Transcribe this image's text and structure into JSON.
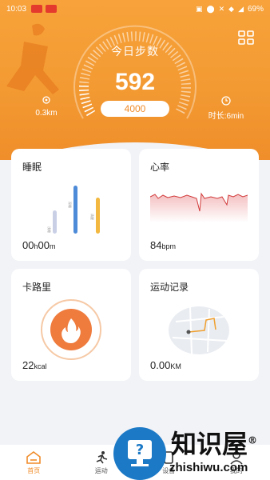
{
  "status_bar": {
    "time": "10:03",
    "battery": "69%"
  },
  "steps": {
    "title": "今日步数",
    "count": "592",
    "goal": "4000",
    "distance": "0.3km",
    "duration": "时长:6min",
    "progress": 0.148
  },
  "cards": {
    "sleep": {
      "title": "睡眠",
      "value_hours": "00",
      "unit_h": "h",
      "value_minutes": "00",
      "unit_m": "m",
      "bars": [
        {
          "label": "浅睡",
          "level": 0.3,
          "color": "#c9d0e6"
        },
        {
          "label": "深睡",
          "level": 0.62,
          "color": "#4d8ad8"
        },
        {
          "label": "清醒",
          "level": 0.46,
          "color": "#f2b840"
        }
      ]
    },
    "heart": {
      "title": "心率",
      "value": "84",
      "unit": "bpm"
    },
    "calories": {
      "title": "卡路里",
      "value": "22",
      "unit": "kcal"
    },
    "record": {
      "title": "运动记录",
      "value": "0.00",
      "unit": "KM"
    }
  },
  "nav": [
    {
      "label": "首页",
      "icon": "home-icon",
      "active": true
    },
    {
      "label": "运动",
      "icon": "run-icon",
      "active": false
    },
    {
      "label": "设备",
      "icon": "device-icon",
      "active": false
    },
    {
      "label": "我的",
      "icon": "profile-icon",
      "active": false
    }
  ],
  "watermark": {
    "title": "知识屋",
    "domain": "zhishiwu.com",
    "mark": "®"
  },
  "colors": {
    "accent": "#f39a33",
    "heart_line": "#d23a3a",
    "flame": "#ef7b3d"
  }
}
